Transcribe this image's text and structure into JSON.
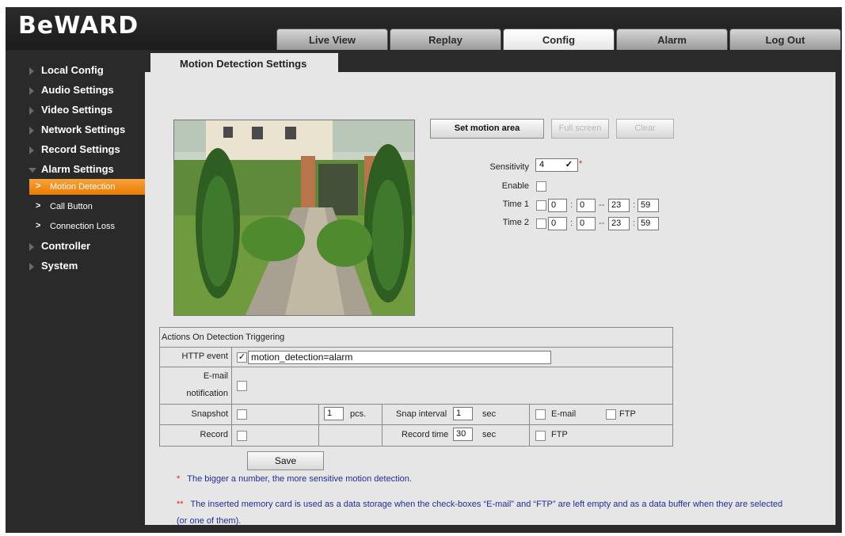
{
  "brand": {
    "logo_text": "BeWARD"
  },
  "nav": {
    "tabs": [
      {
        "label": "Live View",
        "active": false
      },
      {
        "label": "Replay",
        "active": false
      },
      {
        "label": "Config",
        "active": true
      },
      {
        "label": "Alarm",
        "active": false
      },
      {
        "label": "Log Out",
        "active": false
      }
    ]
  },
  "sidebar": {
    "items": [
      {
        "label": "Local Config"
      },
      {
        "label": "Audio Settings"
      },
      {
        "label": "Video Settings"
      },
      {
        "label": "Network Settings"
      },
      {
        "label": "Record Settings"
      },
      {
        "label": "Alarm Settings",
        "expanded": true
      },
      {
        "label": "Controller"
      },
      {
        "label": "System"
      }
    ],
    "subitems": [
      {
        "label": "Motion Detection",
        "active": true
      },
      {
        "label": "Call Button",
        "active": false
      },
      {
        "label": "Connection Loss",
        "active": false
      }
    ],
    "accent_color": "#f0901a"
  },
  "section": {
    "title": "Motion Detection Settings"
  },
  "motion": {
    "set_area_label": "Set motion area",
    "full_screen_label": "Full screen",
    "clear_label": "Clear",
    "sensitivity_label": "Sensitivity",
    "sensitivity_value": "4",
    "required_mark": "*",
    "enable_label": "Enable",
    "enable_checked": false,
    "time1": {
      "label": "Time 1",
      "checked": false,
      "start_h": "0",
      "start_m": "0",
      "end_h": "23",
      "end_m": "59"
    },
    "time2": {
      "label": "Time 2",
      "checked": false,
      "start_h": "0",
      "start_m": "0",
      "end_h": "23",
      "end_m": "59"
    },
    "time_colon": ":",
    "time_dash": "--"
  },
  "actions": {
    "title": "Actions On Detection Triggering",
    "http_event_label": "HTTP event",
    "http_event_checked": true,
    "http_event_value": "motion_detection=alarm",
    "email_label_1": "E-mail",
    "email_label_2": "notification",
    "email_checked": false,
    "snapshot_label": "Snapshot",
    "snapshot_checked": false,
    "snapshot_pcs_value": "1",
    "pcs_unit": "pcs.",
    "snap_interval_label": "Snap interval",
    "snap_interval_value": "1",
    "sec_unit": "sec",
    "snap_email_label": "E-mail",
    "snap_email_checked": false,
    "snap_ftp_label": "FTP",
    "snap_ftp_checked": false,
    "record_label": "Record",
    "record_checked": false,
    "record_time_label": "Record time",
    "record_time_value": "30",
    "record_ftp_label": "FTP",
    "record_ftp_checked": false
  },
  "save_label": "Save",
  "notes": {
    "note1_mark": "*",
    "note1_text": "The bigger a number, the more sensitive motion detection.",
    "note2_mark": "**",
    "note2_text_1": "The inserted memory card is used as a data storage when the check-boxes “E-mail” and “FTP” are left empty and as a data buffer when they are selected",
    "note2_text_2": "(or one of them)."
  }
}
